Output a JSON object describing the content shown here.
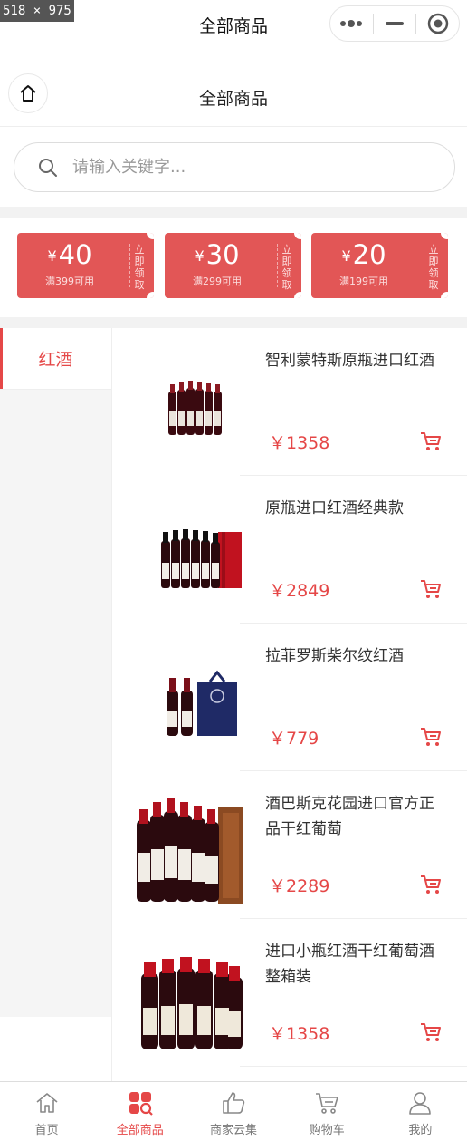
{
  "screenshot_badge": "518 × 975",
  "capsule_header": {
    "title": "全部商品"
  },
  "nav_header": {
    "title": "全部商品"
  },
  "search": {
    "placeholder": "请输入关键字..."
  },
  "coupons": [
    {
      "currency": "¥",
      "amount": "40",
      "condition": "满399可用",
      "claim": "立即领取"
    },
    {
      "currency": "¥",
      "amount": "30",
      "condition": "满299可用",
      "claim": "立即领取"
    },
    {
      "currency": "¥",
      "amount": "20",
      "condition": "满199可用",
      "claim": "立即领取"
    }
  ],
  "sidebar": {
    "items": [
      {
        "label": "红酒",
        "active": true
      }
    ]
  },
  "products": [
    {
      "name": "智利蒙特斯原瓶进口红酒",
      "price": "￥1358"
    },
    {
      "name": "原瓶进口红酒经典款",
      "price": "￥2849"
    },
    {
      "name": "拉菲罗斯柴尔纹红酒",
      "price": "￥779"
    },
    {
      "name": "酒巴斯克花园进口官方正品干红葡萄",
      "price": "￥2289"
    },
    {
      "name": "进口小瓶红酒干红葡萄酒整箱装",
      "price": "￥1358"
    }
  ],
  "tabbar": {
    "items": [
      {
        "label": "首页",
        "icon": "home-icon"
      },
      {
        "label": "全部商品",
        "icon": "category-icon",
        "active": true
      },
      {
        "label": "商家云集",
        "icon": "thumbs-up-icon"
      },
      {
        "label": "购物车",
        "icon": "cart-icon"
      },
      {
        "label": "我的",
        "icon": "user-icon"
      }
    ]
  },
  "colors": {
    "accent": "#e54747",
    "coupon": "#e25656",
    "wine": "#5a0d14"
  }
}
